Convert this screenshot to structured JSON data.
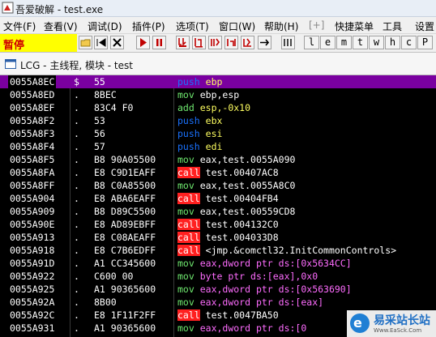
{
  "window": {
    "title": "吾爱破解 - test.exe"
  },
  "menu": [
    {
      "label": "文件(F)"
    },
    {
      "label": "查看(V)"
    },
    {
      "label": "调试(D)"
    },
    {
      "label": "插件(P)"
    },
    {
      "label": "选项(T)"
    },
    {
      "label": "窗口(W)"
    },
    {
      "label": "帮助(H)"
    },
    {
      "label": "[+]"
    },
    {
      "label": "快捷菜单"
    },
    {
      "label": "工具"
    },
    {
      "label": "设置"
    }
  ],
  "toolbar": {
    "status": "暂停",
    "letters": [
      "l",
      "e",
      "m",
      "t",
      "w",
      "h",
      "c",
      "P"
    ]
  },
  "subwindow": {
    "title": "LCG - 主线程, 模块 - test"
  },
  "disasm": [
    {
      "addr": "0055A8EC",
      "mark": "$",
      "hex": "55",
      "mn": "push",
      "op": "ebp",
      "opc": "op-yel",
      "sel": true
    },
    {
      "addr": "0055A8ED",
      "mark": ".",
      "hex": "8BEC",
      "mn": "mov",
      "op": "ebp,esp",
      "opc": "op-white"
    },
    {
      "addr": "0055A8EF",
      "mark": ".",
      "hex": "83C4 F0",
      "mn": "add",
      "op": "esp,-0x10",
      "opc": "op-yel"
    },
    {
      "addr": "0055A8F2",
      "mark": ".",
      "hex": "53",
      "mn": "push",
      "op": "ebx",
      "opc": "op-yel"
    },
    {
      "addr": "0055A8F3",
      "mark": ".",
      "hex": "56",
      "mn": "push",
      "op": "esi",
      "opc": "op-yel"
    },
    {
      "addr": "0055A8F4",
      "mark": ".",
      "hex": "57",
      "mn": "push",
      "op": "edi",
      "opc": "op-yel"
    },
    {
      "addr": "0055A8F5",
      "mark": ".",
      "hex": "B8 90A05500",
      "mn": "mov",
      "op": "eax,test.0055A090",
      "opc": "op-white"
    },
    {
      "addr": "0055A8FA",
      "mark": ".",
      "hex": "E8 C9D1EAFF",
      "mn": "call",
      "op": "test.00407AC8",
      "opc": "op-white"
    },
    {
      "addr": "0055A8FF",
      "mark": ".",
      "hex": "B8 C0A85500",
      "mn": "mov",
      "op": "eax,test.0055A8C0",
      "opc": "op-white"
    },
    {
      "addr": "0055A904",
      "mark": ".",
      "hex": "E8 ABA6EAFF",
      "mn": "call",
      "op": "test.00404FB4",
      "opc": "op-white"
    },
    {
      "addr": "0055A909",
      "mark": ".",
      "hex": "B8 D89C5500",
      "mn": "mov",
      "op": "eax,test.00559CD8",
      "opc": "op-white"
    },
    {
      "addr": "0055A90E",
      "mark": ".",
      "hex": "E8 AD89EBFF",
      "mn": "call",
      "op": "test.004132C0",
      "opc": "op-white"
    },
    {
      "addr": "0055A913",
      "mark": ".",
      "hex": "E8 C08AEAFF",
      "mn": "call",
      "op": "test.004033D8",
      "opc": "op-white"
    },
    {
      "addr": "0055A918",
      "mark": ".",
      "hex": "E8 C7B6EDFF",
      "mn": "call",
      "op": "<jmp.&comctl32.InitCommonControls>",
      "opc": "op-white"
    },
    {
      "addr": "0055A91D",
      "mark": ".",
      "hex": "A1 CC345600",
      "mn": "mov",
      "op": "eax,dword ptr ds:[0x5634CC]",
      "opc": "op-mag"
    },
    {
      "addr": "0055A922",
      "mark": ".",
      "hex": "C600 00",
      "mn": "mov",
      "op": "byte ptr ds:[eax],0x0",
      "opc": "op-mag"
    },
    {
      "addr": "0055A925",
      "mark": ".",
      "hex": "A1 90365600",
      "mn": "mov",
      "op": "eax,dword ptr ds:[0x563690]",
      "opc": "op-mag"
    },
    {
      "addr": "0055A92A",
      "mark": ".",
      "hex": "8B00",
      "mn": "mov",
      "op": "eax,dword ptr ds:[eax]",
      "opc": "op-mag"
    },
    {
      "addr": "0055A92C",
      "mark": ".",
      "hex": "E8 1F11F2FF",
      "mn": "call",
      "op": "test.0047BA50",
      "opc": "op-white"
    },
    {
      "addr": "0055A931",
      "mark": ".",
      "hex": "A1 90365600",
      "mn": "mov",
      "op": "eax,dword ptr ds:[0",
      "opc": "op-mag"
    }
  ],
  "watermark": {
    "text": "易采站长站",
    "sub": "Www.EaSck.Com",
    "logo": "e"
  },
  "colors": {
    "paused_bg": "#ffff00",
    "selected_row": "#7a00a0",
    "call_bg": "#ff2020",
    "push": "#1a72ff",
    "mov": "#6fe96f"
  }
}
